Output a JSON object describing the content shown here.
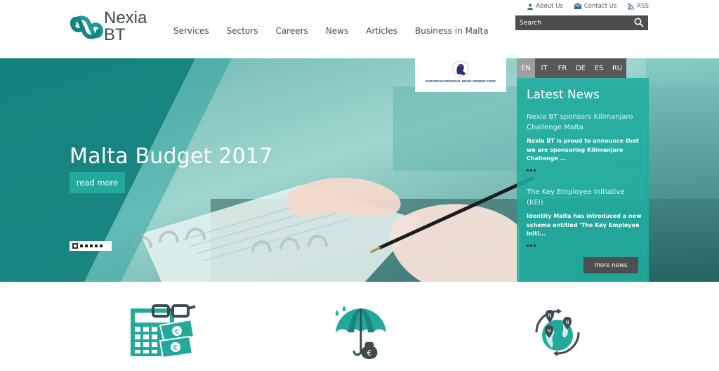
{
  "header": {
    "logo": {
      "line1": "Nexia",
      "line2": "BT"
    },
    "nav": [
      {
        "label": "Services"
      },
      {
        "label": "Sectors"
      },
      {
        "label": "Careers"
      },
      {
        "label": "News"
      },
      {
        "label": "Articles"
      },
      {
        "label": "Business in Malta"
      }
    ],
    "util_links": {
      "about": "About Us",
      "contact": "Contact Us",
      "rss": "RSS"
    },
    "search": {
      "placeholder": "Search"
    }
  },
  "hero": {
    "title": "Malta Budget 2017",
    "read_more": "read more",
    "slides_count": 6,
    "active_slide": 1,
    "erdf": {
      "line": "EUROPEAN REGIONAL DEVELOPMENT FUND"
    }
  },
  "languages": [
    "EN",
    "IT",
    "FR",
    "DE",
    "ES",
    "RU"
  ],
  "active_language": "EN",
  "latest_news": {
    "title": "Latest News",
    "items": [
      {
        "headline": "Nexia BT sponsors Kilimanjaro Challenge Malta",
        "excerpt": "Nexia BT is proud to announce that we are sponsoring Kilimanjaro Challenge ..."
      },
      {
        "headline": "The Key Employee Initiative (KEI)",
        "excerpt": "Identity Malta has introduced a new scheme entitled 'The Key Employee Initi..."
      }
    ],
    "more_label": "more news"
  },
  "colors": {
    "accent": "#22a99c",
    "dark_teal": "#1a6f70",
    "nav_text": "#4a4a4a",
    "panel_dark": "#4e4e4e"
  },
  "icons": {
    "features": [
      "calculator-money-icon",
      "umbrella-moneybag-icon",
      "globe-locations-icon"
    ]
  }
}
